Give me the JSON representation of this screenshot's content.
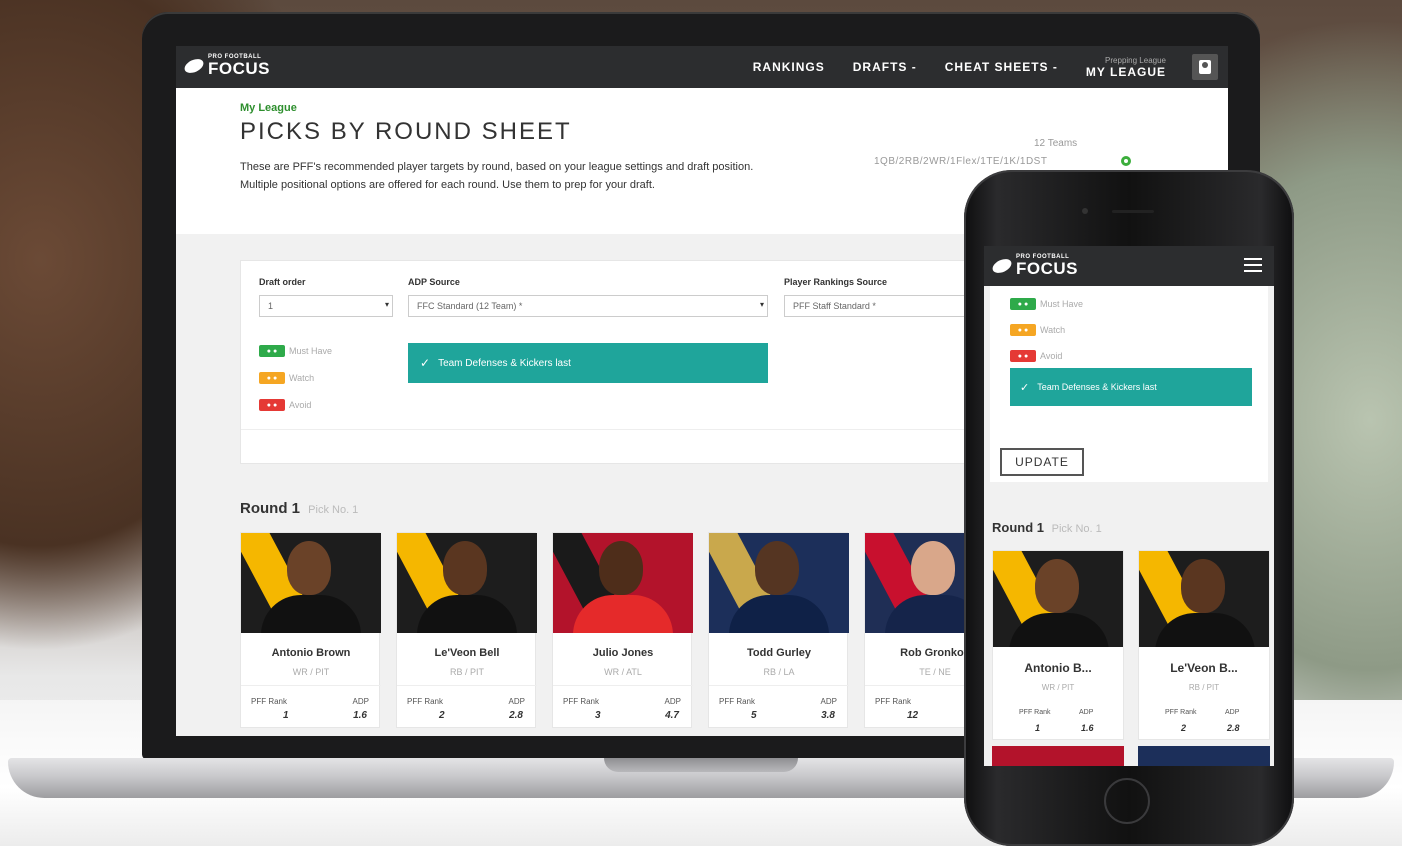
{
  "brand": {
    "logo_small": "PRO FOOTBALL",
    "logo_big": "FOCUS"
  },
  "nav": {
    "items": [
      "RANKINGS",
      "DRAFTS -",
      "CHEAT SHEETS -"
    ],
    "league_sub": "Prepping League",
    "league": "MY LEAGUE"
  },
  "header": {
    "breadcrumb": "My League",
    "title": "PICKS BY ROUND SHEET",
    "description": "These are PFF's recommended player targets by round, based on your league settings and draft position. Multiple positional options are offered for each round. Use them to prep for your draft.",
    "teams": "12 Teams",
    "format": "1QB/2RB/2WR/1Flex/1TE/1K/1DST"
  },
  "settings": {
    "draft_order_label": "Draft order",
    "draft_order_value": "1",
    "adp_label": "ADP Source",
    "adp_value": "FFC Standard (12 Team) *",
    "rankings_label": "Player Rankings Source",
    "rankings_value": "PFF Staff Standard *",
    "legend": [
      {
        "badge": "● ●",
        "label": "Must Have",
        "color": "#2eaa4a"
      },
      {
        "badge": "● ●",
        "label": "Watch",
        "color": "#f5a623"
      },
      {
        "badge": "● ●",
        "label": "Avoid",
        "color": "#e53935"
      }
    ],
    "toggle_label": "Team Defenses & Kickers last"
  },
  "round": {
    "title": "Round 1",
    "pick": "Pick No. 1"
  },
  "rank_label": "PFF Rank",
  "adp_label": "ADP",
  "players": [
    {
      "name": "Antonio Brown",
      "pos": "WR / PIT",
      "rank": "1",
      "adp": "1.6"
    },
    {
      "name": "Le'Veon Bell",
      "pos": "RB / PIT",
      "rank": "2",
      "adp": "2.8"
    },
    {
      "name": "Julio Jones",
      "pos": "WR / ATL",
      "rank": "3",
      "adp": "4.7"
    },
    {
      "name": "Todd Gurley",
      "pos": "RB / LA",
      "rank": "5",
      "adp": "3.8"
    },
    {
      "name": "Rob Gronkov",
      "pos": "TE / NE",
      "rank": "12",
      "adp": ""
    }
  ],
  "mobile": {
    "update_label": "UPDATE",
    "players": [
      {
        "name": "Antonio B...",
        "pos": "WR / PIT",
        "rank": "1",
        "adp": "1.6"
      },
      {
        "name": "Le'Veon B...",
        "pos": "RB / PIT",
        "rank": "2",
        "adp": "2.8"
      }
    ]
  }
}
